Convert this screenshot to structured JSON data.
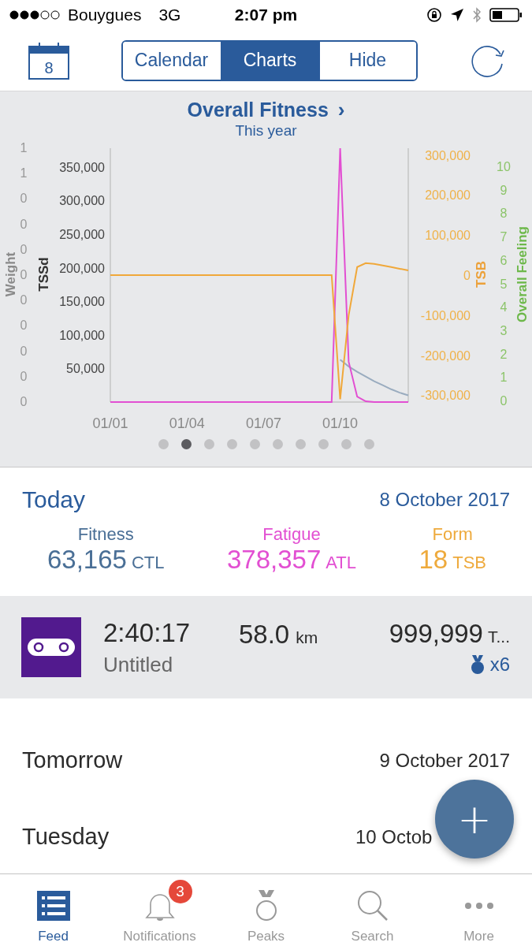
{
  "status_bar": {
    "carrier": "Bouygues",
    "network": "3G",
    "time": "2:07 pm"
  },
  "nav": {
    "calendar_day": "8",
    "segments": [
      {
        "label": "Calendar",
        "selected": false
      },
      {
        "label": "Charts",
        "selected": true
      },
      {
        "label": "Hide",
        "selected": false
      }
    ]
  },
  "chart_panel": {
    "title": "Overall Fitness",
    "chevron": "›",
    "subtitle": "This year",
    "weight_axis": {
      "title": "Weight",
      "ticks": [
        "1",
        "1",
        "0",
        "0",
        "0",
        "0",
        "0",
        "0",
        "0",
        "0",
        "0"
      ]
    },
    "feeling_axis": {
      "title": "Overall Feeling",
      "ticks": [
        "10",
        "9",
        "8",
        "7",
        "6",
        "5",
        "4",
        "3",
        "2",
        "1",
        "0"
      ]
    },
    "chart_data": {
      "type": "line",
      "ylabel": "TSSd",
      "ylim": [
        0,
        378000
      ],
      "y2label": "TSB",
      "y2lim": [
        -317000,
        317000
      ],
      "y2ticks": [
        {
          "value": 300000,
          "label": "300,000"
        },
        {
          "value": 200000,
          "label": "200,000"
        },
        {
          "value": 100000,
          "label": "100,000"
        },
        {
          "value": 0,
          "label": "0"
        },
        {
          "value": -100000,
          "label": "-100,000"
        },
        {
          "value": -200000,
          "label": "-200,000"
        },
        {
          "value": -300000,
          "label": "-300,000"
        }
      ],
      "categories": [
        "01/01",
        null,
        null,
        null,
        null,
        null,
        null,
        null,
        null,
        "01/04",
        null,
        null,
        null,
        null,
        null,
        null,
        null,
        null,
        "01/07",
        null,
        null,
        null,
        null,
        null,
        null,
        null,
        null,
        "01/10",
        null,
        null,
        null,
        null,
        null,
        null,
        null,
        null
      ],
      "yticks": [
        {
          "value": 50000,
          "label": "50,000"
        },
        {
          "value": 100000,
          "label": "100,000"
        },
        {
          "value": 150000,
          "label": "150,000"
        },
        {
          "value": 200000,
          "label": "200,000"
        },
        {
          "value": 250000,
          "label": "250,000"
        },
        {
          "value": 300000,
          "label": "300,000"
        },
        {
          "value": 350000,
          "label": "350,000"
        }
      ],
      "series": [
        {
          "color": "#9aacbf",
          "values": [
            null,
            null,
            null,
            null,
            null,
            null,
            null,
            null,
            null,
            null,
            null,
            null,
            null,
            null,
            null,
            null,
            null,
            null,
            null,
            null,
            null,
            null,
            null,
            null,
            null,
            null,
            null,
            63000,
            53000,
            45000,
            38000,
            31000,
            25000,
            19000,
            14000,
            10000
          ]
        },
        {
          "color": "#e24fd2",
          "values": [
            0,
            0,
            0,
            0,
            0,
            0,
            0,
            0,
            0,
            0,
            0,
            0,
            0,
            0,
            0,
            0,
            0,
            0,
            0,
            0,
            0,
            0,
            0,
            0,
            0,
            0,
            0,
            378000,
            60000,
            8000,
            1000,
            0,
            0,
            0,
            0,
            0
          ]
        },
        {
          "color": "#f0a83a",
          "axis": "y2",
          "values": [
            0,
            0,
            0,
            0,
            0,
            0,
            0,
            0,
            0,
            0,
            0,
            0,
            0,
            0,
            0,
            0,
            0,
            0,
            0,
            0,
            0,
            0,
            0,
            0,
            0,
            0,
            0,
            -310000,
            -100000,
            20000,
            30000,
            28000,
            24000,
            20000,
            16000,
            12000
          ]
        }
      ]
    },
    "pages": [
      {
        "selected": false
      },
      {
        "selected": true
      },
      {
        "selected": false
      },
      {
        "selected": false
      },
      {
        "selected": false
      },
      {
        "selected": false
      },
      {
        "selected": false
      },
      {
        "selected": false
      },
      {
        "selected": false
      },
      {
        "selected": false
      }
    ]
  },
  "today": {
    "label": "Today",
    "date": "8 October 2017",
    "metrics": [
      {
        "name": "Fitness",
        "value": "63,165",
        "unit": "CTL",
        "color": "#4a6f96"
      },
      {
        "name": "Fatigue",
        "value": "378,357",
        "unit": "ATL",
        "color": "#e24fd2"
      },
      {
        "name": "Form",
        "value": "18",
        "unit": "TSB",
        "color": "#eeaa3c"
      }
    ]
  },
  "activity": {
    "duration": "2:40:17",
    "title": "Untitled",
    "distance": "58.0",
    "distance_unit": "km",
    "score": "999,999",
    "score_unit": "T...",
    "medals": "x6"
  },
  "days": [
    {
      "label": "Tomorrow",
      "date": "9 October 2017"
    },
    {
      "label": "Tuesday",
      "date": "10 Octob"
    }
  ],
  "fab": {
    "symbol": "+"
  },
  "tab_bar": [
    {
      "label": "Feed",
      "selected": true
    },
    {
      "label": "Notifications",
      "selected": false,
      "badge": "3"
    },
    {
      "label": "Peaks",
      "selected": false
    },
    {
      "label": "Search",
      "selected": false
    },
    {
      "label": "More",
      "selected": false
    }
  ]
}
